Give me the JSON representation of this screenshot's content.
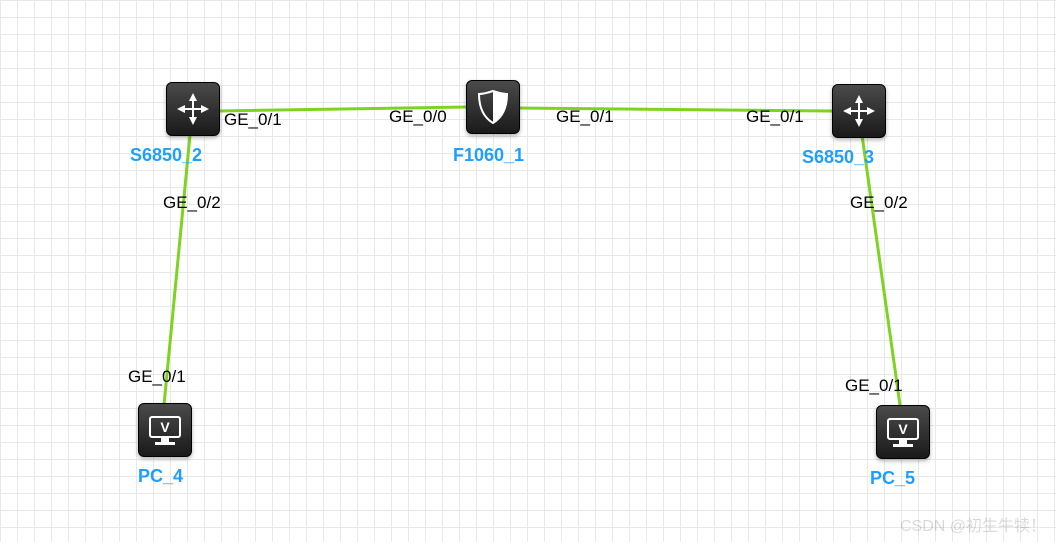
{
  "nodes": {
    "s6850_2": {
      "label": "S6850_2",
      "type": "switch"
    },
    "f1060_1": {
      "label": "F1060_1",
      "type": "firewall"
    },
    "s6850_3": {
      "label": "S6850_3",
      "type": "switch"
    },
    "pc_4": {
      "label": "PC_4",
      "type": "pc"
    },
    "pc_5": {
      "label": "PC_5",
      "type": "pc"
    }
  },
  "ports": {
    "s6850_2_ge01": "GE_0/1",
    "s6850_2_ge02": "GE_0/2",
    "f1060_1_ge00": "GE_0/0",
    "f1060_1_ge01": "GE_0/1",
    "s6850_3_ge01": "GE_0/1",
    "s6850_3_ge02": "GE_0/2",
    "pc_4_ge01": "GE_0/1",
    "pc_5_ge01": "GE_0/1"
  },
  "links": [
    {
      "from": "s6850_2",
      "from_port": "GE_0/1",
      "to": "f1060_1",
      "to_port": "GE_0/0"
    },
    {
      "from": "f1060_1",
      "from_port": "GE_0/1",
      "to": "s6850_3",
      "to_port": "GE_0/1"
    },
    {
      "from": "s6850_2",
      "from_port": "GE_0/2",
      "to": "pc_4",
      "to_port": "GE_0/1"
    },
    {
      "from": "s6850_3",
      "from_port": "GE_0/2",
      "to": "pc_5",
      "to_port": "GE_0/1"
    }
  ],
  "watermark": "CSDN @初生牛犊！",
  "colors": {
    "link": "#7ed321",
    "label": "#1e9fff"
  }
}
